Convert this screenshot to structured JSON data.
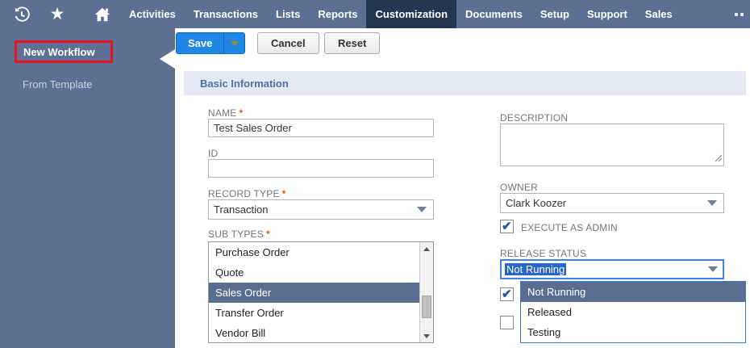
{
  "nav": {
    "icons": [
      "history-icon",
      "star-icon",
      "home-icon",
      "more-dots-icon"
    ],
    "items": [
      {
        "label": "Activities",
        "active": false
      },
      {
        "label": "Transactions",
        "active": false
      },
      {
        "label": "Lists",
        "active": false
      },
      {
        "label": "Reports",
        "active": false
      },
      {
        "label": "Customization",
        "active": true
      },
      {
        "label": "Documents",
        "active": false
      },
      {
        "label": "Setup",
        "active": false
      },
      {
        "label": "Support",
        "active": false
      },
      {
        "label": "Sales",
        "active": false
      }
    ]
  },
  "sidebar": {
    "items": [
      {
        "label": "New Workflow",
        "selected": true,
        "annotated": "red-box"
      },
      {
        "label": "From Template",
        "selected": false
      }
    ]
  },
  "toolbar": {
    "save_label": "Save",
    "cancel_label": "Cancel",
    "reset_label": "Reset"
  },
  "section": {
    "title": "Basic Information"
  },
  "form": {
    "required_marker": "*",
    "name": {
      "label": "NAME",
      "required": true,
      "value": "Test Sales Order"
    },
    "id": {
      "label": "ID",
      "required": false,
      "value": ""
    },
    "record_type": {
      "label": "RECORD TYPE",
      "required": true,
      "value": "Transaction"
    },
    "sub_types": {
      "label": "SUB TYPES",
      "required": true,
      "options": [
        "Purchase Order",
        "Quote",
        "Sales Order",
        "Transfer Order",
        "Vendor Bill"
      ],
      "selected": "Sales Order"
    },
    "description": {
      "label": "DESCRIPTION",
      "value": ""
    },
    "owner": {
      "label": "OWNER",
      "value": "Clark Koozer"
    },
    "execute_as_admin": {
      "label": "EXECUTE AS ADMIN",
      "checked": true
    },
    "release_status": {
      "label": "RELEASE STATUS",
      "value": "Not Running",
      "dropdown_open": true,
      "options": [
        "Not Running",
        "Released",
        "Testing"
      ],
      "highlighted": "Not Running"
    }
  },
  "colors": {
    "nav_bar": "#5d7094",
    "active_tab": "#253650",
    "sidebar": "#5d7094",
    "save_button": "#1e87e5",
    "save_arrow": "#a6872f",
    "annotation_red": "#e81123",
    "section_header_bg": "#e3e9f2",
    "section_header_text": "#50719f",
    "list_highlight": "#5a6e91",
    "text_selection_blue": "#2a65c8",
    "focus_border": "#3d85e8",
    "label_gray": "#757575",
    "required_asterisk": "#f04e23",
    "checkmark_blue": "#2457a0"
  }
}
